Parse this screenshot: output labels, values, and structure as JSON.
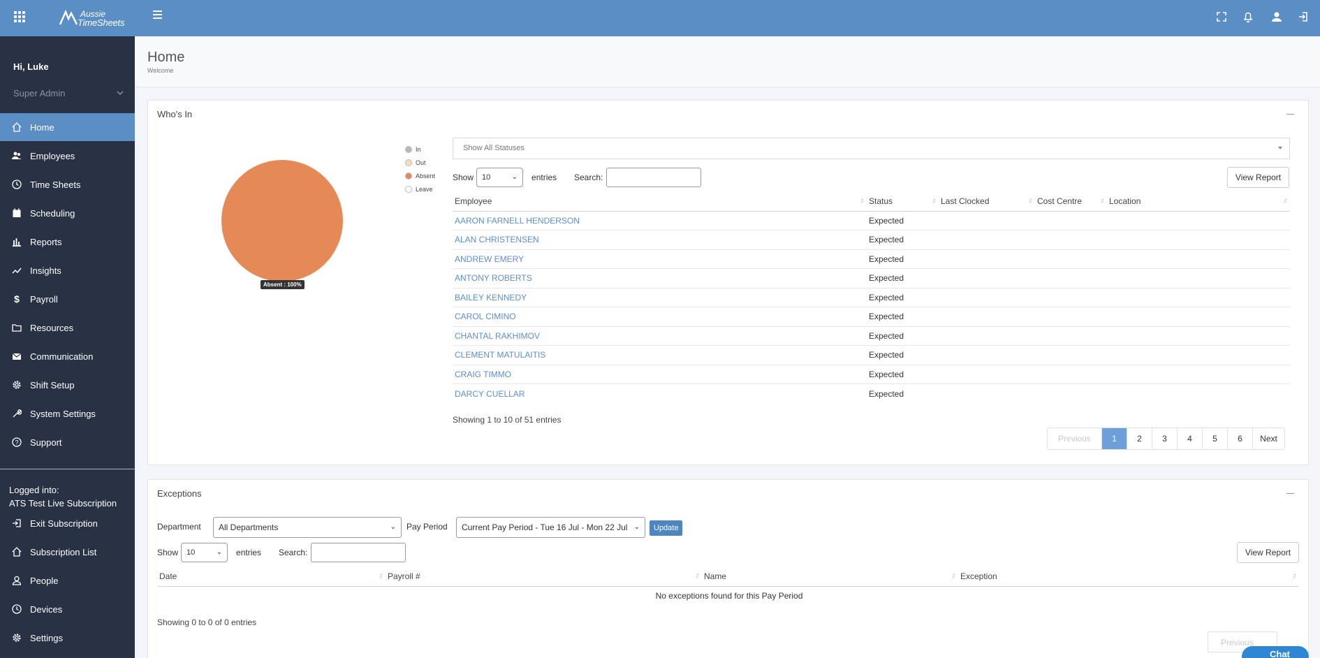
{
  "brand": {
    "line1": "Aussie",
    "line2": "TimeSheets"
  },
  "sidebar": {
    "greeting": "Hi, Luke",
    "role": "Super Admin",
    "items": [
      {
        "label": "Home",
        "icon": "home-icon"
      },
      {
        "label": "Employees",
        "icon": "users-icon"
      },
      {
        "label": "Time Sheets",
        "icon": "clock-icon"
      },
      {
        "label": "Scheduling",
        "icon": "calendar-icon"
      },
      {
        "label": "Reports",
        "icon": "bar-chart-icon"
      },
      {
        "label": "Insights",
        "icon": "trend-icon"
      },
      {
        "label": "Payroll",
        "icon": "dollar-icon"
      },
      {
        "label": "Resources",
        "icon": "folder-icon"
      },
      {
        "label": "Communication",
        "icon": "envelope-icon"
      },
      {
        "label": "Shift Setup",
        "icon": "gear-icon"
      },
      {
        "label": "System Settings",
        "icon": "wrench-icon"
      },
      {
        "label": "Support",
        "icon": "help-icon"
      }
    ],
    "logged_label": "Logged into:",
    "logged_value": "ATS Test Live Subscription",
    "sub_items": [
      {
        "label": "Exit Subscription",
        "icon": "exit-icon"
      },
      {
        "label": "Subscription List",
        "icon": "home-icon"
      },
      {
        "label": "People",
        "icon": "person-icon"
      },
      {
        "label": "Devices",
        "icon": "clock-icon"
      },
      {
        "label": "Settings",
        "icon": "gear-icon"
      }
    ]
  },
  "header": {
    "title": "Home",
    "subtitle": "Welcome"
  },
  "whos_in": {
    "title": "Who's In",
    "legend": [
      {
        "label": "In",
        "color": "#b9b9b9"
      },
      {
        "label": "Out",
        "color": "#f3dfb3"
      },
      {
        "label": "Absent",
        "color": "#e58a57"
      },
      {
        "label": "Leave",
        "color": "#ffffff"
      }
    ],
    "pie_tooltip": "Absent : 100%",
    "pie_color": "#e58a57",
    "status_filter": "Show All Statuses",
    "show_label": "Show",
    "entries_value": "10",
    "entries_label": "entries",
    "search_label": "Search:",
    "view_report": "View Report",
    "columns": [
      "Employee",
      "Status",
      "Last Clocked",
      "Cost Centre",
      "Location"
    ],
    "rows": [
      {
        "employee": "AARON FARNELL HENDERSON",
        "status": "Expected"
      },
      {
        "employee": "ALAN CHRISTENSEN",
        "status": "Expected"
      },
      {
        "employee": "ANDREW EMERY",
        "status": "Expected"
      },
      {
        "employee": "ANTONY ROBERTS",
        "status": "Expected"
      },
      {
        "employee": "BAILEY KENNEDY",
        "status": "Expected"
      },
      {
        "employee": "CAROL CIMINO",
        "status": "Expected"
      },
      {
        "employee": "CHANTAL RAKHIMOV",
        "status": "Expected"
      },
      {
        "employee": "CLEMENT MATULAITIS",
        "status": "Expected"
      },
      {
        "employee": "CRAIG TIMMO",
        "status": "Expected"
      },
      {
        "employee": "DARCY CUELLAR",
        "status": "Expected"
      }
    ],
    "info": "Showing 1 to 10 of 51 entries",
    "pager": {
      "previous": "Previous",
      "pages": [
        "1",
        "2",
        "3",
        "4",
        "5",
        "6"
      ],
      "current": "1",
      "next": "Next"
    }
  },
  "exceptions": {
    "title": "Exceptions",
    "department_label": "Department",
    "department_value": "All Departments",
    "pay_period_label": "Pay Period",
    "pay_period_value": "Current Pay Period - Tue 16 Jul - Mon 22 Jul",
    "update": "Update",
    "show_label": "Show",
    "entries_value": "10",
    "entries_label": "entries",
    "search_label": "Search:",
    "view_report": "View Report",
    "columns": [
      "Date",
      "Payroll #",
      "Name",
      "Exception"
    ],
    "empty": "No exceptions found for this Pay Period",
    "info": "Showing 0 to 0 of 0 entries",
    "pager_prev": "Previous"
  },
  "chat": {
    "label": "Chat"
  }
}
